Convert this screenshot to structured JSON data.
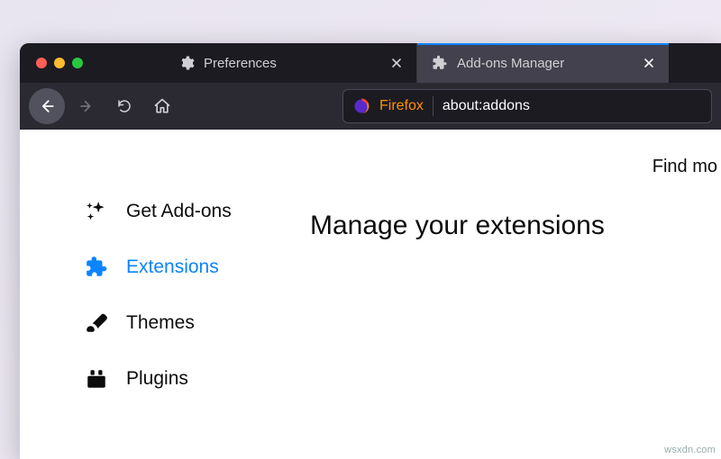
{
  "tabs": [
    {
      "label": "Preferences",
      "active": false
    },
    {
      "label": "Add-ons Manager",
      "active": true
    }
  ],
  "urlbar": {
    "identity_label": "Firefox",
    "address": "about:addons"
  },
  "sidebar": {
    "items": [
      {
        "label": "Get Add-ons"
      },
      {
        "label": "Extensions"
      },
      {
        "label": "Themes"
      },
      {
        "label": "Plugins"
      }
    ],
    "active_index": 1
  },
  "main": {
    "find_more_label": "Find mo",
    "heading": "Manage your extensions"
  },
  "watermark": "wsxdn.com"
}
